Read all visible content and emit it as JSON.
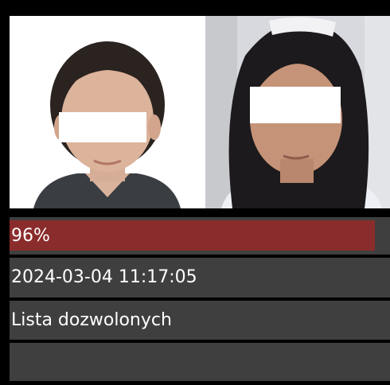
{
  "match_card": {
    "similarity": {
      "label": "96%",
      "fraction": 0.96,
      "bar_color": "#8b2c2c"
    },
    "timestamp": "2024-03-04 11:17:05",
    "list_name": "Lista dozwolonych",
    "extra": ""
  },
  "colors": {
    "background": "#000000",
    "row_background": "#3f3f3f",
    "text": "#ffffff"
  }
}
